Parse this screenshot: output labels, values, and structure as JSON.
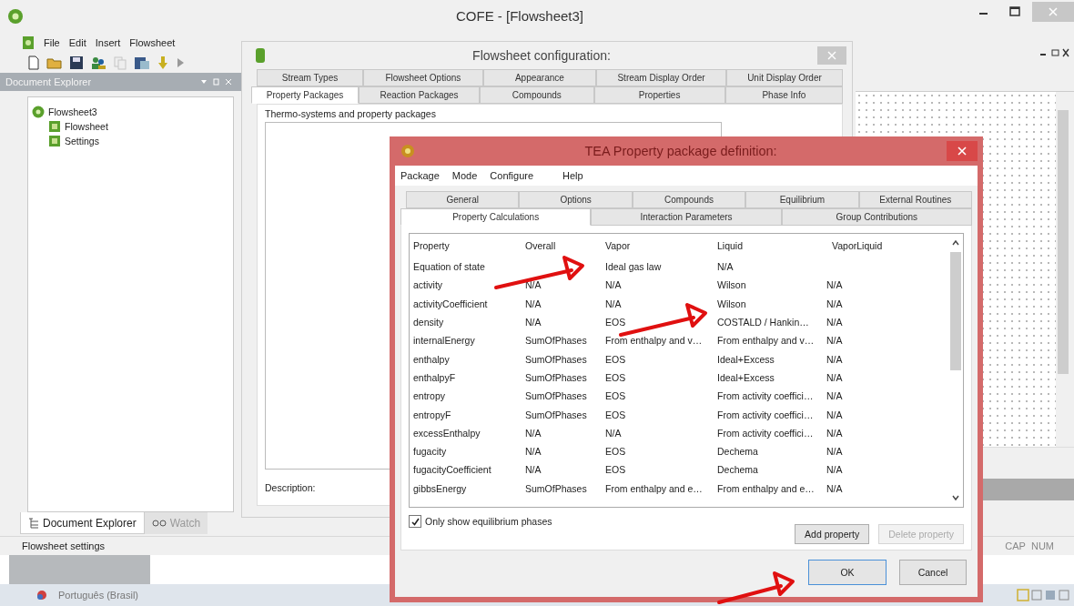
{
  "window": {
    "title": "COFE - [Flowsheet3]"
  },
  "menu": [
    "File",
    "Edit",
    "Insert",
    "Flowsheet"
  ],
  "document_explorer": {
    "title": "Document Explorer",
    "tree": [
      {
        "label": "Flowsheet3",
        "children": [
          {
            "label": "Flowsheet"
          },
          {
            "label": "Settings"
          }
        ]
      }
    ],
    "tabs": [
      {
        "label": "Document Explorer",
        "selected": true
      },
      {
        "label": "Watch",
        "selected": false
      }
    ]
  },
  "config_dialog": {
    "title": "Flowsheet configuration:",
    "tab_rows": [
      [
        {
          "label": "Stream Types",
          "selected": false
        },
        {
          "label": "Flowsheet Options",
          "selected": false
        },
        {
          "label": "Appearance",
          "selected": false
        },
        {
          "label": "Stream Display Order",
          "selected": false
        },
        {
          "label": "Unit Display Order",
          "selected": false
        }
      ],
      [
        {
          "label": "Property Packages",
          "selected": true
        },
        {
          "label": "Reaction Packages",
          "selected": false
        },
        {
          "label": "Compounds",
          "selected": false
        },
        {
          "label": "Properties",
          "selected": false
        },
        {
          "label": "Phase Info",
          "selected": false
        }
      ]
    ],
    "section_label": "Thermo-systems and property packages",
    "description_label": "Description:"
  },
  "tea_dialog": {
    "title": "TEA Property package definition:",
    "menu": [
      "Package",
      "Mode",
      "Configure",
      "Help"
    ],
    "tab_rows": [
      [
        {
          "label": "General",
          "selected": false
        },
        {
          "label": "Options",
          "selected": false
        },
        {
          "label": "Compounds",
          "selected": false
        },
        {
          "label": "Equilibrium",
          "selected": false
        },
        {
          "label": "External Routines",
          "selected": false
        }
      ],
      [
        {
          "label": "Property Calculations",
          "selected": true
        },
        {
          "label": "Interaction Parameters",
          "selected": false
        },
        {
          "label": "Group Contributions",
          "selected": false
        }
      ]
    ],
    "table": {
      "columns": [
        "Property",
        "Overall",
        "Vapor",
        "Liquid",
        "VaporLiquid"
      ],
      "rows": [
        [
          "Equation of state",
          null,
          "Ideal gas law",
          "N/A",
          null
        ],
        [
          "activity",
          "N/A",
          "N/A",
          "Wilson",
          "N/A"
        ],
        [
          "activityCoefficient",
          "N/A",
          "N/A",
          "Wilson",
          "N/A"
        ],
        [
          "density",
          "N/A",
          "EOS",
          "COSTALD / Hankin…",
          "N/A"
        ],
        [
          "internalEnergy",
          "SumOfPhases",
          "From enthalpy and v…",
          "From enthalpy and v…",
          "N/A"
        ],
        [
          "enthalpy",
          "SumOfPhases",
          "EOS",
          "Ideal+Excess",
          "N/A"
        ],
        [
          "enthalpyF",
          "SumOfPhases",
          "EOS",
          "Ideal+Excess",
          "N/A"
        ],
        [
          "entropy",
          "SumOfPhases",
          "EOS",
          "From activity coeffici…",
          "N/A"
        ],
        [
          "entropyF",
          "SumOfPhases",
          "EOS",
          "From activity coeffici…",
          "N/A"
        ],
        [
          "excessEnthalpy",
          "N/A",
          "N/A",
          "From activity coeffici…",
          "N/A"
        ],
        [
          "fugacity",
          "N/A",
          "EOS",
          "Dechema",
          "N/A"
        ],
        [
          "fugacityCoefficient",
          "N/A",
          "EOS",
          "Dechema",
          "N/A"
        ],
        [
          "gibbsEnergy",
          "SumOfPhases",
          "From enthalpy and e…",
          "From enthalpy and e…",
          "N/A"
        ]
      ]
    },
    "only_equilibrium": {
      "label": "Only show equilibrium phases",
      "checked": true
    },
    "buttons": [
      {
        "label": "Add property",
        "disabled": false
      },
      {
        "label": "Delete property",
        "disabled": true
      }
    ],
    "ok": "OK",
    "cancel": "Cancel"
  },
  "status_bar": {
    "text": "Flowsheet settings",
    "indicators": [
      "CAP",
      "NUM"
    ]
  },
  "taskbar": {
    "language": "Português (Brasil)"
  }
}
